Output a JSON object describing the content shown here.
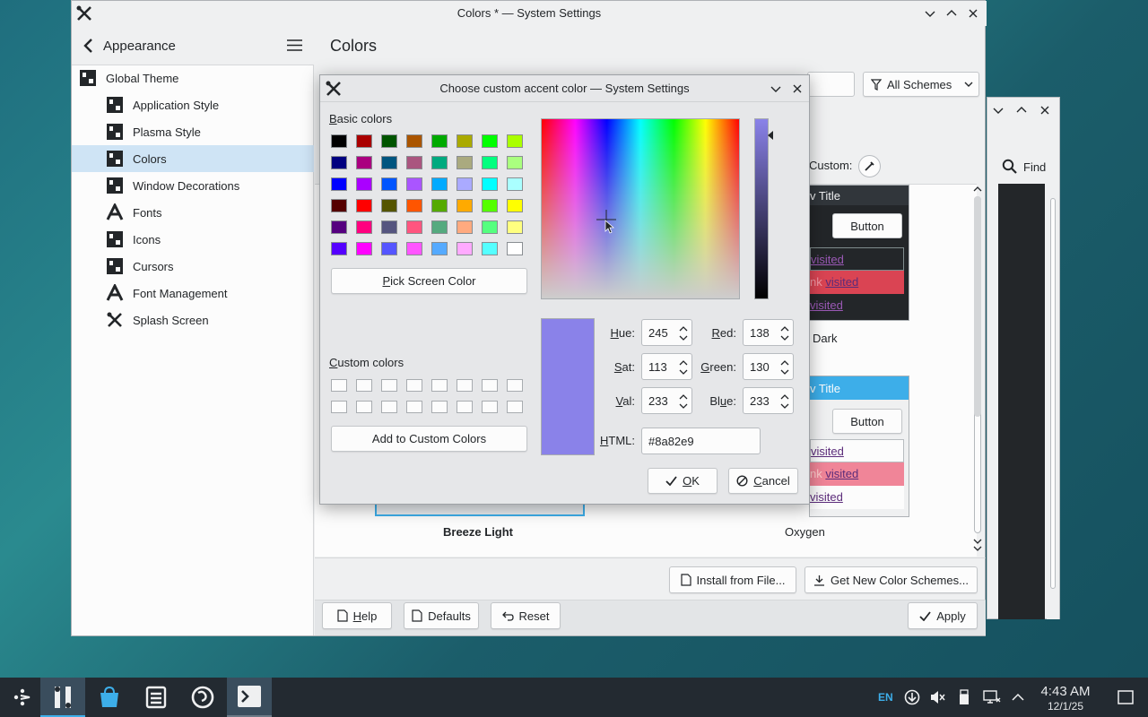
{
  "main_window": {
    "title": "Colors * — System Settings",
    "sidebar": {
      "header": "Appearance",
      "items": [
        {
          "label": "Global Theme",
          "icon": "global-theme-icon"
        },
        {
          "label": "Application Style",
          "icon": "style-icon"
        },
        {
          "label": "Plasma Style",
          "icon": "plasma-style-icon"
        },
        {
          "label": "Colors",
          "icon": "colors-icon",
          "selected": true
        },
        {
          "label": "Window Decorations",
          "icon": "window-decorations-icon"
        },
        {
          "label": "Fonts",
          "icon": "fonts-icon"
        },
        {
          "label": "Icons",
          "icon": "icons-icon"
        },
        {
          "label": "Cursors",
          "icon": "cursors-icon"
        },
        {
          "label": "Font Management",
          "icon": "font-management-icon"
        },
        {
          "label": "Splash Screen",
          "icon": "splash-screen-icon"
        }
      ]
    },
    "content": {
      "title": "Colors",
      "filter_label": "All Schemes",
      "custom_label": "Custom:",
      "preview_window_title": "v Title",
      "preview_button": "Button",
      "preview_link_visited": "visited",
      "preview_link_prefix": "nk",
      "schemes": [
        {
          "name": "Breeze Light",
          "bold": true
        },
        {
          "name": "Oxygen"
        },
        {
          "name": "Dark"
        }
      ],
      "install_button": "Install from File...",
      "get_new_button": "Get New Color Schemes..."
    },
    "footer": {
      "help": "Help",
      "defaults": "Defaults",
      "reset": "Reset",
      "apply": "Apply"
    }
  },
  "background_window": {
    "find_label": "Find"
  },
  "dialog": {
    "title": "Choose custom accent color — System Settings",
    "basic_colors_label": "Basic colors",
    "basic_colors": [
      [
        "#000000",
        "#aa0000",
        "#005500",
        "#aa5500",
        "#00aa00",
        "#aaaa00",
        "#00ff00",
        "#aaff00"
      ],
      [
        "#00007f",
        "#aa007f",
        "#00557f",
        "#aa557f",
        "#00aa7f",
        "#aaaa7f",
        "#00ff7f",
        "#aaff7f"
      ],
      [
        "#0000ff",
        "#aa00ff",
        "#0055ff",
        "#aa55ff",
        "#00aaff",
        "#aaaaff",
        "#00ffff",
        "#aaffff"
      ],
      [
        "#550000",
        "#ff0000",
        "#555500",
        "#ff5500",
        "#55aa00",
        "#ffaa00",
        "#55ff00",
        "#ffff00"
      ],
      [
        "#55007f",
        "#ff007f",
        "#55557f",
        "#ff557f",
        "#55aa7f",
        "#ffaa7f",
        "#55ff7f",
        "#ffff7f"
      ],
      [
        "#5500ff",
        "#ff00ff",
        "#5555ff",
        "#ff55ff",
        "#55aaff",
        "#ffaaff",
        "#55ffff",
        "#ffffff"
      ]
    ],
    "pick_screen_color": "Pick Screen Color",
    "custom_colors_label": "Custom colors",
    "add_custom": "Add to Custom Colors",
    "current_color": "#8a82e9",
    "fields": {
      "hue": {
        "label": "Hue:",
        "value": "245"
      },
      "sat": {
        "label": "Sat:",
        "value": "113"
      },
      "val": {
        "label": "Val:",
        "value": "233"
      },
      "red": {
        "label": "Red:",
        "value": "138"
      },
      "green": {
        "label": "Green:",
        "value": "130"
      },
      "blue": {
        "label": "Blue:",
        "value": "233"
      },
      "html": {
        "label": "HTML:",
        "value": "#8a82e9"
      }
    },
    "ok": "OK",
    "cancel": "Cancel"
  },
  "taskbar": {
    "language": "EN",
    "time": "4:43 AM",
    "date": "12/1/25"
  },
  "colors": {
    "accent": "#3daee9",
    "selection": "#cfe4f5",
    "panel": "#232a31"
  }
}
